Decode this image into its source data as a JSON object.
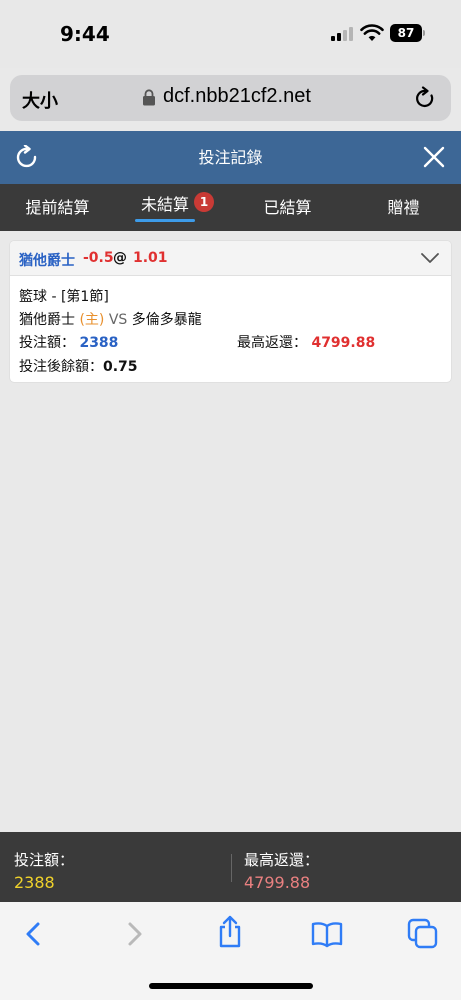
{
  "status": {
    "time": "9:44",
    "battery": "87"
  },
  "browser": {
    "text_size": "大小",
    "url": "dcf.nbb21cf2.net"
  },
  "header": {
    "title": "投注記錄"
  },
  "tabs": [
    {
      "label": "提前結算"
    },
    {
      "label": "未結算",
      "badge": "1"
    },
    {
      "label": "已結算"
    },
    {
      "label": "贈禮"
    }
  ],
  "bet": {
    "selection": "猶他爵士",
    "handicap": "-0.5",
    "at": "@",
    "odds": "1.01",
    "league": "籃球 - [第1節]",
    "home_team": "猶他爵士",
    "home_tag": "(主)",
    "vs": "VS",
    "away_team": "多倫多暴龍",
    "stake_label": "投注額：",
    "stake": "2388",
    "max_return_label": "最高返還：",
    "max_return": "4799.88",
    "remaining_label": "投注後餘額：",
    "remaining": "0.75"
  },
  "summary": {
    "stake_label": "投注額：",
    "stake": "2388",
    "return_label": "最高返還：",
    "return": "4799.88"
  },
  "colors": {
    "header_bg": "#3d6796",
    "tabs_bg": "#3a3a3a",
    "accent_blue": "#2a62c4",
    "accent_red": "#e03030",
    "badge_red": "#c93a35",
    "summary_stake": "#f0d22b",
    "summary_return": "#e98080",
    "safari_blue": "#2f7cf6"
  },
  "icons": [
    "signal-icon",
    "wifi-icon",
    "battery-icon",
    "lock-icon",
    "reload-icon",
    "refresh-icon",
    "close-icon",
    "chevron-down-icon",
    "back-icon",
    "forward-icon",
    "share-icon",
    "bookmarks-icon",
    "tabs-icon"
  ]
}
